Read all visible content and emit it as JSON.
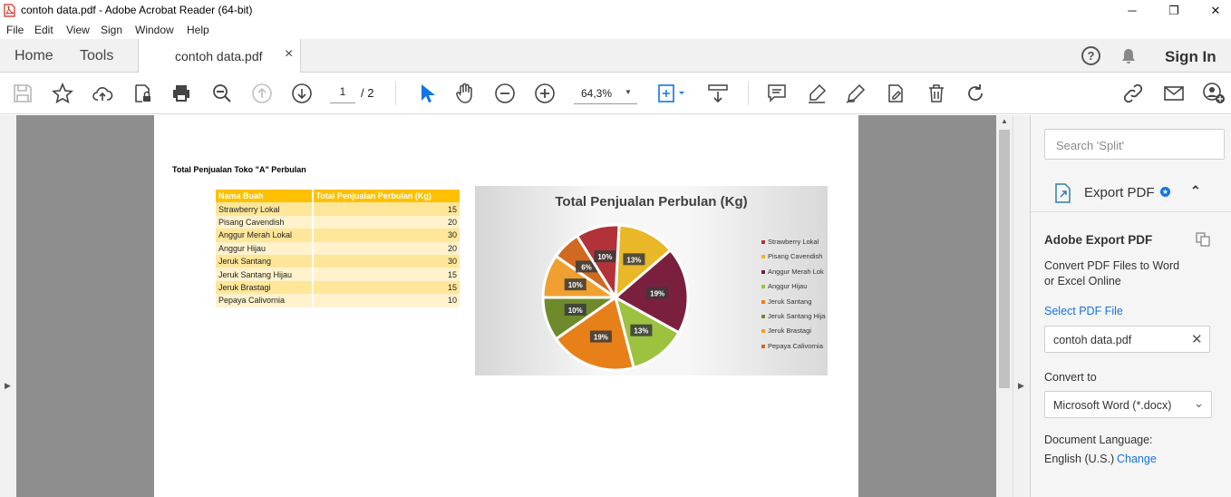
{
  "window": {
    "title": "contoh data.pdf - Adobe Acrobat Reader (64-bit)",
    "minimize": "─",
    "maximize": "❐",
    "close": "✕"
  },
  "menu": [
    "File",
    "Edit",
    "View",
    "Sign",
    "Window",
    "Help"
  ],
  "tabs": {
    "home": "Home",
    "tools": "Tools",
    "document": "contoh data.pdf",
    "close": "×"
  },
  "header_right": {
    "help": "?",
    "sign_in": "Sign In"
  },
  "toolbar": {
    "page_current": "1",
    "page_total": "/ 2",
    "zoom": "64,3%"
  },
  "page": {
    "heading": "Total Penjualan Toko \"A\" Perbulan",
    "table": {
      "headers": [
        "Nama Buah",
        "Total Penjualan Perbulan (Kg)"
      ],
      "rows": [
        [
          "Strawberry Lokal",
          "15"
        ],
        [
          "Pisang Cavendish",
          "20"
        ],
        [
          "Anggur Merah Lokal",
          "30"
        ],
        [
          "Anggur Hijau",
          "20"
        ],
        [
          "Jeruk Santang",
          "30"
        ],
        [
          "Jeruk Santang Hijau",
          "15"
        ],
        [
          "Jeruk Brastagi",
          "15"
        ],
        [
          "Pepaya Calivornia",
          "10"
        ]
      ]
    }
  },
  "chart_data": {
    "type": "pie",
    "title": "Total Penjualan Perbulan (Kg)",
    "categories": [
      "Strawberry Lokal",
      "Pisang Cavendish",
      "Anggur Merah Lokal",
      "Anggur Hijau",
      "Jeruk Santang",
      "Jeruk Santang Hijau",
      "Jeruk Brastagi",
      "Pepaya Calivornia"
    ],
    "values": [
      15,
      20,
      30,
      20,
      30,
      15,
      15,
      10
    ],
    "data_labels": [
      "10%",
      "13%",
      "19%",
      "13%",
      "19%",
      "10%",
      "10%",
      "6%"
    ],
    "colors": [
      "#b2323a",
      "#e8b828",
      "#7a1f3d",
      "#9cc240",
      "#e8801a",
      "#6f8a2a",
      "#f0a030",
      "#d06a20"
    ],
    "legend_position": "right",
    "legend": [
      "Strawberry Lokal",
      "Pisang Cavendish",
      "Anggur Merah Lok",
      "Anggur Hijau",
      "Jeruk Santang",
      "Jeruk Santang Hija",
      "Jeruk Brastagi",
      "Pepaya Calivornia"
    ]
  },
  "right_panel": {
    "search_placeholder": "Search 'Split'",
    "export_title": "Export PDF",
    "section_title": "Adobe Export PDF",
    "description_line1": "Convert PDF Files to Word",
    "description_line2": "or Excel Online",
    "select_file_link": "Select PDF File",
    "selected_file": "contoh data.pdf",
    "convert_to_label": "Convert to",
    "convert_to_value": "Microsoft Word (*.docx)",
    "doc_lang_label": "Document Language:",
    "doc_lang_value": "English (U.S.)",
    "change_link": "Change"
  }
}
